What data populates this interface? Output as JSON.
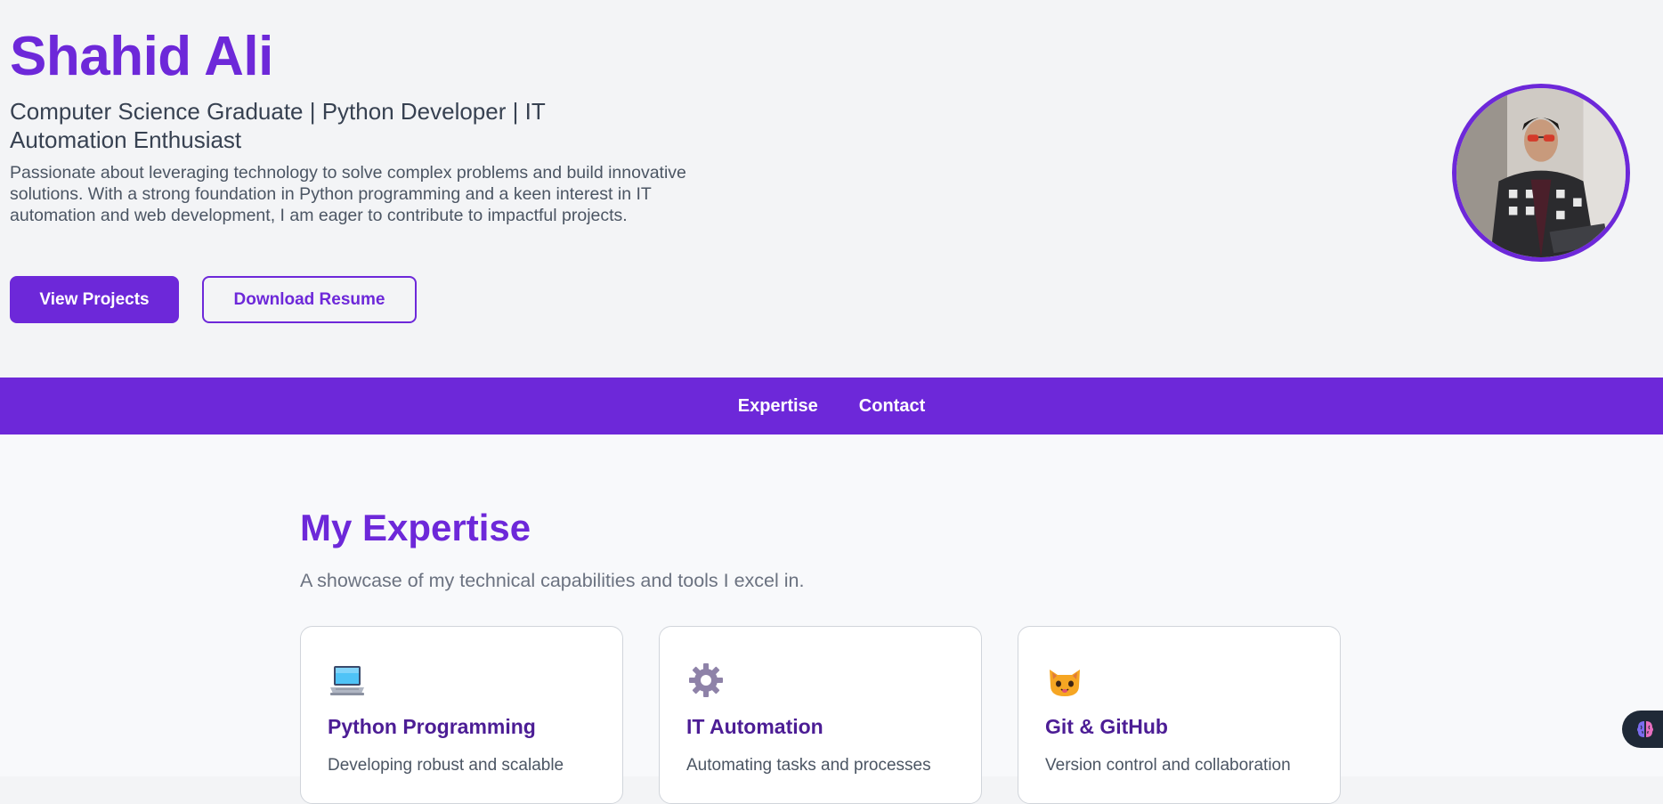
{
  "hero": {
    "name": "Shahid Ali",
    "tagline": "Computer Science Graduate | Python Developer | IT Automation Enthusiast",
    "description": "Passionate about leveraging technology to solve complex problems and build innovative solutions. With a strong foundation in Python programming and a keen interest in IT automation and web development, I am eager to contribute to impactful projects.",
    "primary_button": "View Projects",
    "secondary_button": "Download Resume"
  },
  "nav": {
    "items": [
      {
        "label": "Expertise"
      },
      {
        "label": "Contact"
      }
    ]
  },
  "expertise": {
    "title": "My Expertise",
    "subtitle": "A showcase of my technical capabilities and tools I excel in.",
    "cards": [
      {
        "icon": "laptop-icon",
        "title": "Python Programming",
        "description": "Developing robust and scalable"
      },
      {
        "icon": "gear-icon",
        "title": "IT Automation",
        "description": "Automating tasks and processes"
      },
      {
        "icon": "cat-icon",
        "title": "Git & GitHub",
        "description": "Version control and collaboration"
      }
    ]
  },
  "colors": {
    "accent": "#6d28d9",
    "card_title": "#4c1d95",
    "page_background": "#f3f4f6"
  },
  "widget": {
    "icon": "brain-icon"
  }
}
